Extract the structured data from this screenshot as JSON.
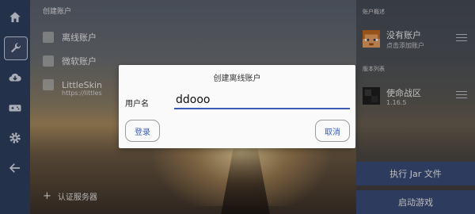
{
  "sidebar": {
    "icons": [
      "home-icon",
      "wrench-icon",
      "cloud-download-icon",
      "gamepad-icon",
      "gear-icon",
      "back-arrow-icon"
    ]
  },
  "accounts": {
    "header": "创建账户",
    "items": [
      {
        "label": "离线账户"
      },
      {
        "label": "微软账户"
      },
      {
        "label": "LittleSkin",
        "sub": "https://littles"
      }
    ],
    "auth_server": "认证服务器"
  },
  "right_panel": {
    "account_label": "账户概述",
    "account_title": "没有账户",
    "account_sub": "点击添加账户",
    "version_label": "版本列表",
    "version_title": "使命战区",
    "version_sub": "1.16.5",
    "run_jar": "执行 Jar 文件",
    "launch": "启动游戏"
  },
  "dialog": {
    "title": "创建离线账户",
    "username_label": "用户名",
    "username_value": "ddooo",
    "login_button": "登录",
    "cancel_button": "取消"
  },
  "colors": {
    "rail": "#2f3f5f",
    "accent": "#3b5bb5",
    "button_bg": "#3a4d79"
  }
}
